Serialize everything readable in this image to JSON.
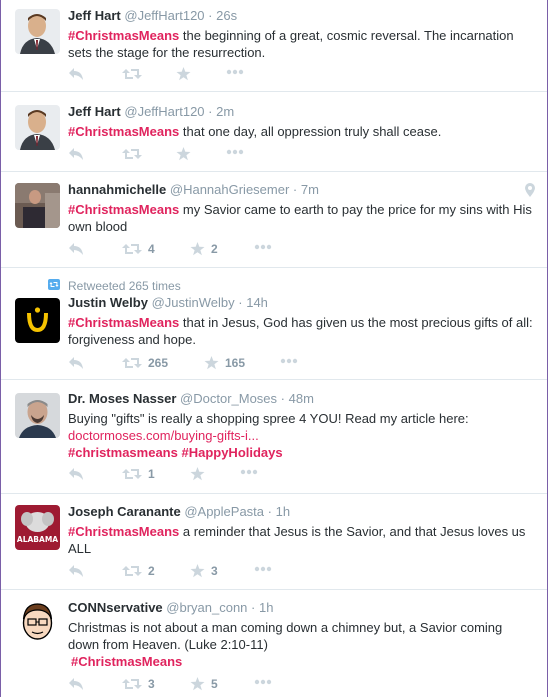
{
  "colors": {
    "hashtag": "#e0245e",
    "muted": "#8899a6",
    "icon": "#ccd6dd",
    "frame": "#7a5fa8"
  },
  "tweets": [
    {
      "fullname": "Jeff Hart",
      "username": "@JeffHart120",
      "sep": "·",
      "time": "26s",
      "hashtag": "#ChristmasMeans",
      "text": " the beginning of a great, cosmic reversal. The incarnation sets the stage for the resurrection.",
      "retweets": "",
      "favorites": ""
    },
    {
      "fullname": "Jeff Hart",
      "username": "@JeffHart120",
      "sep": "·",
      "time": "2m",
      "hashtag": "#ChristmasMeans",
      "text": " that one day, all oppression truly shall cease.",
      "retweets": "",
      "favorites": ""
    },
    {
      "fullname": "hannahmichelle",
      "username": "@HannahGriesemer",
      "sep": "·",
      "time": "7m",
      "hashtag": "#ChristmasMeans",
      "text": " my Savior came to earth to pay the price for my sins with His own blood",
      "retweets": "4",
      "favorites": "2"
    },
    {
      "retweet_context": "Retweeted 265 times",
      "fullname": "Justin Welby",
      "username": "@JustinWelby",
      "sep": "·",
      "time": "14h",
      "hashtag": "#ChristmasMeans",
      "text": " that in Jesus, God has given us the most precious gifts of all: forgiveness and hope.",
      "retweets": "265",
      "favorites": "165"
    },
    {
      "fullname": "Dr. Moses Nasser",
      "username": "@Doctor_Moses",
      "sep": "·",
      "time": "48m",
      "text": "Buying \"gifts\" is really a shopping spree 4 YOU! Read my article here:",
      "link": "doctormoses.com/buying-gifts-i...",
      "hashtag": "#christmasmeans",
      "hashtag2": "#HappyHolidays",
      "retweets": "1",
      "favorites": ""
    },
    {
      "fullname": "Joseph Caranante",
      "username": "@ApplePasta",
      "sep": "·",
      "time": "1h",
      "hashtag": "#ChristmasMeans",
      "text": " a reminder that Jesus is the Savior, and that Jesus loves us ALL",
      "retweets": "2",
      "favorites": "3",
      "avatar_text": "ALABAMA"
    },
    {
      "fullname": "CONNservative",
      "username": "@bryan_conn",
      "sep": "·",
      "time": "1h",
      "text": "Christmas is not about a man coming down a chimney but, a Savior coming down from Heaven. (Luke 2:10-11)",
      "hashtag": "#ChristmasMeans",
      "retweets": "3",
      "favorites": "5"
    }
  ],
  "icons": {
    "reply": "reply-icon",
    "retweet": "retweet-icon",
    "favorite": "star-icon",
    "more": "more-icon",
    "geo": "location-pin-icon"
  }
}
